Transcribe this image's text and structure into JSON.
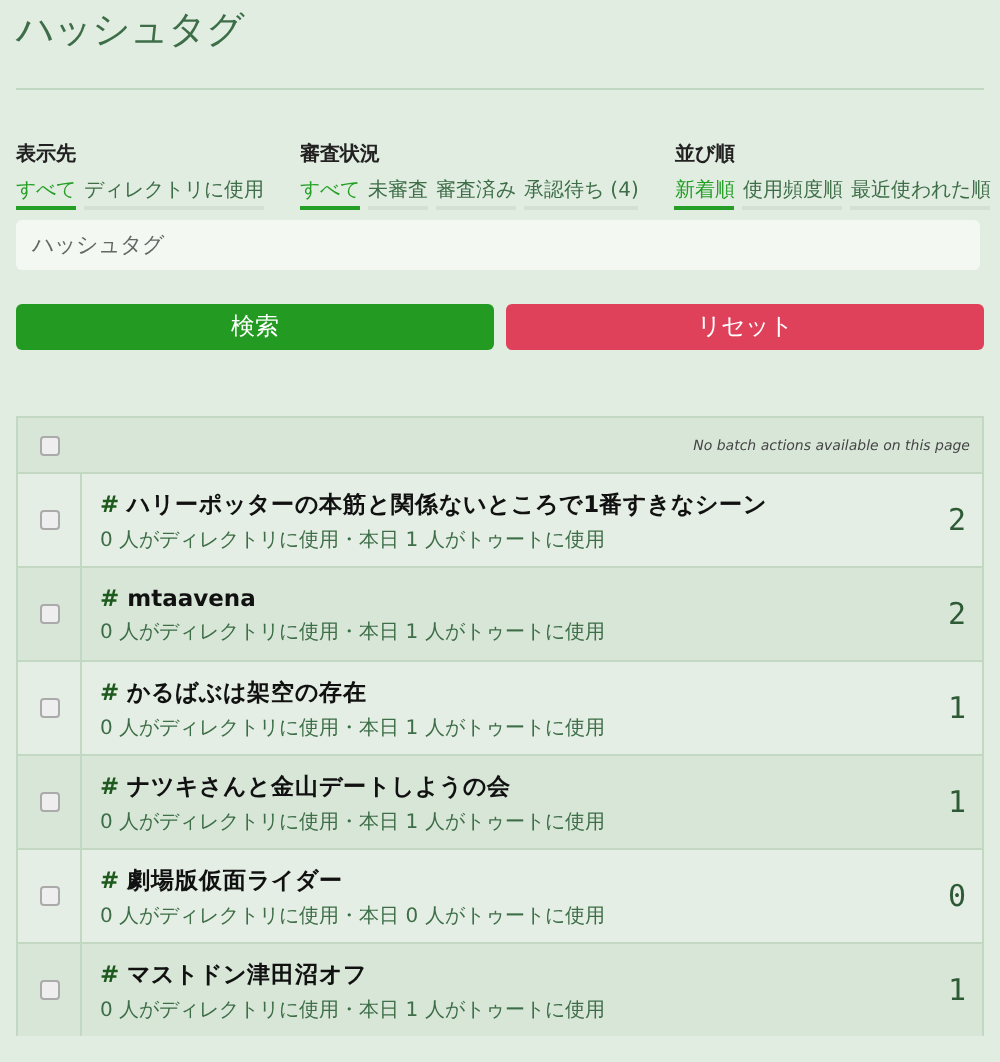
{
  "page": {
    "title": "ハッシュタグ"
  },
  "filters": [
    {
      "label": "表示先",
      "options": [
        {
          "label": "すべて",
          "selected": true
        },
        {
          "label": "ディレクトリに使用",
          "selected": false
        }
      ]
    },
    {
      "label": "審査状況",
      "options": [
        {
          "label": "すべて",
          "selected": true
        },
        {
          "label": "未審査",
          "selected": false
        },
        {
          "label": "審査済み",
          "selected": false
        },
        {
          "label": "承認待ち (4)",
          "selected": false
        }
      ]
    },
    {
      "label": "並び順",
      "options": [
        {
          "label": "新着順",
          "selected": true
        },
        {
          "label": "使用頻度順",
          "selected": false
        },
        {
          "label": "最近使われた順",
          "selected": false
        }
      ]
    }
  ],
  "search": {
    "placeholder": "ハッシュタグ"
  },
  "buttons": [
    {
      "label": "検索",
      "kind": "primary"
    },
    {
      "label": "リセット",
      "kind": "danger"
    }
  ],
  "table": {
    "header": {
      "checked": false,
      "notice": "No batch actions available on this page"
    },
    "rows": [
      {
        "checked": false,
        "prefix": "#",
        "tag": "ハリーポッターの本筋と関係ないところで1番すきなシーン",
        "stats": "0 人がディレクトリに使用・本日 1 人がトゥートに使用",
        "count": "2"
      },
      {
        "checked": false,
        "prefix": "#",
        "tag": "mtaavena",
        "stats": "0 人がディレクトリに使用・本日 1 人がトゥートに使用",
        "count": "2"
      },
      {
        "checked": false,
        "prefix": "#",
        "tag": "かるばぶは架空の存在",
        "stats": "0 人がディレクトリに使用・本日 1 人がトゥートに使用",
        "count": "1"
      },
      {
        "checked": false,
        "prefix": "#",
        "tag": "ナツキさんと金山デートしようの会",
        "stats": "0 人がディレクトリに使用・本日 1 人がトゥートに使用",
        "count": "1"
      },
      {
        "checked": false,
        "prefix": "#",
        "tag": "劇場版仮面ライダー",
        "stats": "0 人がディレクトリに使用・本日 0 人がトゥートに使用",
        "count": "0"
      },
      {
        "checked": false,
        "prefix": "#",
        "tag": "マストドン津田沼オフ",
        "stats": "0 人がディレクトリに使用・本日 1 人がトゥートに使用",
        "count": "1"
      }
    ]
  }
}
